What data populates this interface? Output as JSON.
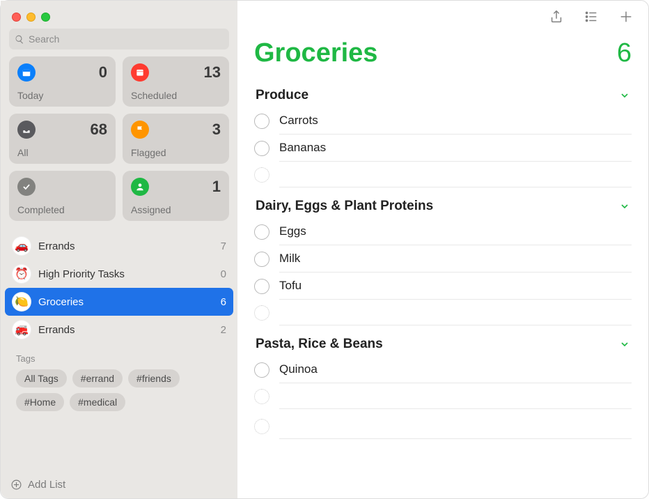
{
  "accent": "#1fb844",
  "search": {
    "placeholder": "Search"
  },
  "cards": {
    "today": {
      "label": "Today",
      "count": 0,
      "bg": "#0a7ffb"
    },
    "scheduled": {
      "label": "Scheduled",
      "count": 13,
      "bg": "#ff3b30"
    },
    "all": {
      "label": "All",
      "count": 68,
      "bg": "#5a5a5e"
    },
    "flagged": {
      "label": "Flagged",
      "count": 3,
      "bg": "#ff9500"
    },
    "completed": {
      "label": "Completed",
      "count": "",
      "bg": "#82827f"
    },
    "assigned": {
      "label": "Assigned",
      "count": 1,
      "bg": "#1fb844"
    }
  },
  "lists": [
    {
      "name": "Errands",
      "count": 7,
      "emoji": "🚗",
      "selected": false
    },
    {
      "name": "High Priority Tasks",
      "count": 0,
      "emoji": "⏰",
      "selected": false
    },
    {
      "name": "Groceries",
      "count": 6,
      "emoji": "🍋",
      "selected": true
    },
    {
      "name": "Errands",
      "count": 2,
      "emoji": "🚒",
      "selected": false
    }
  ],
  "tags": {
    "title": "Tags",
    "items": [
      "All Tags",
      "#errand",
      "#friends",
      "#Home",
      "#medical"
    ]
  },
  "addList": "Add List",
  "main": {
    "title": "Groceries",
    "count": 6,
    "sections": [
      {
        "name": "Produce",
        "items": [
          "Carrots",
          "Bananas"
        ]
      },
      {
        "name": "Dairy, Eggs & Plant Proteins",
        "items": [
          "Eggs",
          "Milk",
          "Tofu"
        ]
      },
      {
        "name": "Pasta, Rice & Beans",
        "items": [
          "Quinoa"
        ]
      }
    ]
  }
}
